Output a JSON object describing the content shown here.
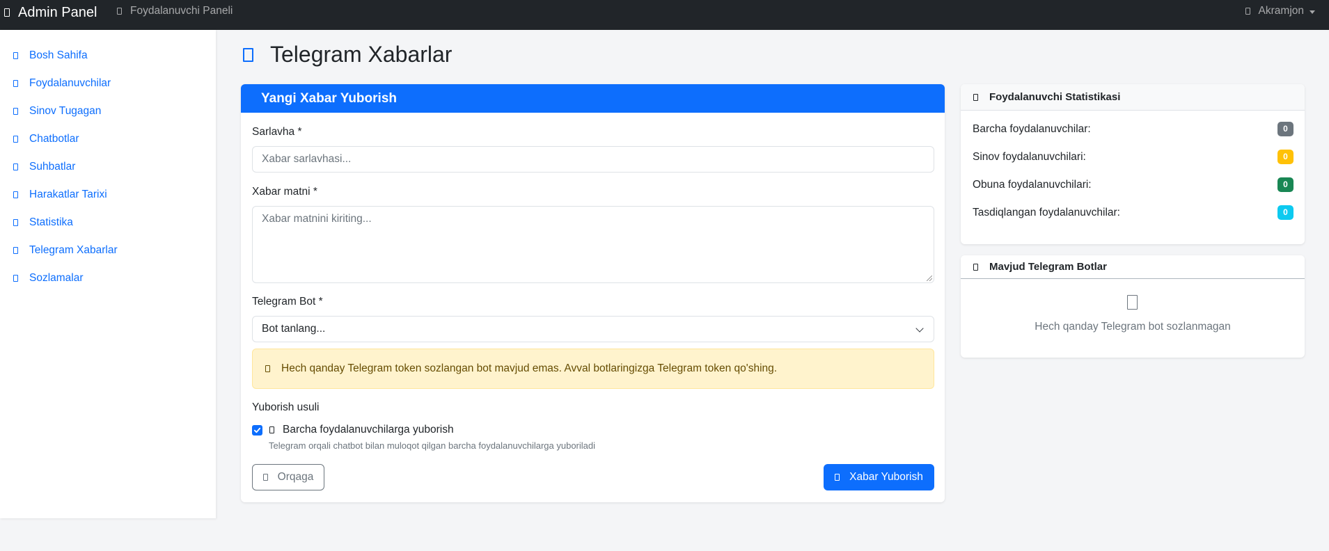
{
  "navbar": {
    "brand": "Admin Panel",
    "section_link": "Foydalanuvchi Paneli",
    "user_name": "Akramjon"
  },
  "sidebar": {
    "items": [
      {
        "label": "Bosh Sahifa"
      },
      {
        "label": "Foydalanuvchilar"
      },
      {
        "label": "Sinov Tugagan"
      },
      {
        "label": "Chatbotlar"
      },
      {
        "label": "Suhbatlar"
      },
      {
        "label": "Harakatlar Tarixi"
      },
      {
        "label": "Statistika"
      },
      {
        "label": "Telegram Xabarlar"
      },
      {
        "label": "Sozlamalar"
      }
    ]
  },
  "page": {
    "title": "Telegram Xabarlar"
  },
  "form": {
    "header": "Yangi Xabar Yuborish",
    "title_label": "Sarlavha *",
    "title_placeholder": "Xabar sarlavhasi...",
    "message_label": "Xabar matni *",
    "message_placeholder": "Xabar matnini kiriting...",
    "bot_label": "Telegram Bot *",
    "bot_selected": "Bot tanlang...",
    "warning": "Hech qanday Telegram token sozlangan bot mavjud emas. Avval botlaringizga Telegram token qo'shing.",
    "send_method_label": "Yuborish usuli",
    "send_all_label": "Barcha foydalanuvchilarga yuborish",
    "send_all_checked": true,
    "send_all_help": "Telegram orqali chatbot bilan muloqot qilgan barcha foydalanuvchilarga yuboriladi",
    "back_button": "Orqaga",
    "send_button": "Xabar Yuborish"
  },
  "stats": {
    "header": "Foydalanuvchi Statistikasi",
    "rows": [
      {
        "label": "Barcha foydalanuvchilar:",
        "value": "0",
        "color": "#6c757d"
      },
      {
        "label": "Sinov foydalanuvchilari:",
        "value": "0",
        "color": "#ffc107"
      },
      {
        "label": "Obuna foydalanuvchilari:",
        "value": "0",
        "color": "#198754"
      },
      {
        "label": "Tasdiqlangan foydalanuvchilar:",
        "value": "0",
        "color": "#0dcaf0"
      }
    ]
  },
  "bots": {
    "header": "Mavjud Telegram Botlar",
    "empty_text": "Hech qanday Telegram bot sozlanmagan"
  },
  "colors": {
    "primary": "#0d6efd",
    "navbar": "#212529",
    "warning_bg": "#fff3cd"
  }
}
